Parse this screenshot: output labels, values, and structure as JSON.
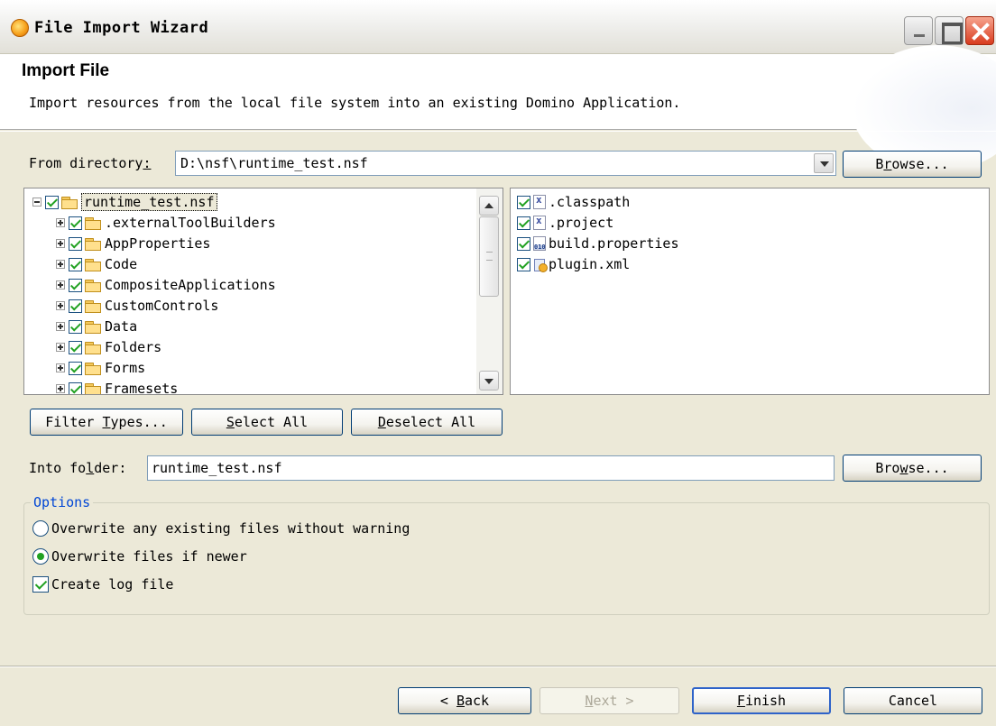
{
  "window": {
    "title": "File Import Wizard"
  },
  "header": {
    "title": "Import File",
    "description": "Import resources from the local file system into an existing Domino Application."
  },
  "from_directory": {
    "label_pre": "From directory",
    "label_ul": ":",
    "value": "D:\\nsf\\runtime_test.nsf",
    "browse_pre": "B",
    "browse_ul": "r",
    "browse_post": "owse..."
  },
  "tree": {
    "root": {
      "label": "runtime_test.nsf",
      "checked": true
    },
    "items": [
      {
        "label": ".externalToolBuilders",
        "checked": true
      },
      {
        "label": "AppProperties",
        "checked": true
      },
      {
        "label": "Code",
        "checked": true
      },
      {
        "label": "CompositeApplications",
        "checked": true
      },
      {
        "label": "CustomControls",
        "checked": true
      },
      {
        "label": "Data",
        "checked": true
      },
      {
        "label": "Folders",
        "checked": true
      },
      {
        "label": "Forms",
        "checked": true
      },
      {
        "label": "Framesets",
        "checked": true
      }
    ]
  },
  "files": [
    {
      "label": ".classpath",
      "icon": "xml-file-icon",
      "checked": true
    },
    {
      "label": ".project",
      "icon": "xml-file-icon",
      "checked": true
    },
    {
      "label": "build.properties",
      "icon": "properties-file-icon",
      "checked": true
    },
    {
      "label": "plugin.xml",
      "icon": "plugin-file-icon",
      "checked": true
    }
  ],
  "selection_buttons": {
    "filter_pre": "Filter ",
    "filter_ul": "T",
    "filter_post": "ypes...",
    "select_all_ul": "S",
    "select_all_post": "elect All",
    "deselect_all_ul": "D",
    "deselect_all_post": "eselect All"
  },
  "into_folder": {
    "label_pre": "Into fo",
    "label_ul": "l",
    "label_post": "der:",
    "value": "runtime_test.nsf",
    "browse_pre": "Bro",
    "browse_ul": "w",
    "browse_post": "se..."
  },
  "options": {
    "title": "Options",
    "overwrite_without_warning": {
      "label": "Overwrite any existing files without warning",
      "selected": false
    },
    "overwrite_if_newer": {
      "label": "Overwrite files if newer",
      "selected": true
    },
    "create_log": {
      "label": "Create log file",
      "checked": true
    }
  },
  "footer": {
    "back_pre": "< ",
    "back_ul": "B",
    "back_post": "ack",
    "next_ul": "N",
    "next_post": "ext >",
    "finish_ul": "F",
    "finish_post": "inish",
    "cancel": "Cancel"
  }
}
